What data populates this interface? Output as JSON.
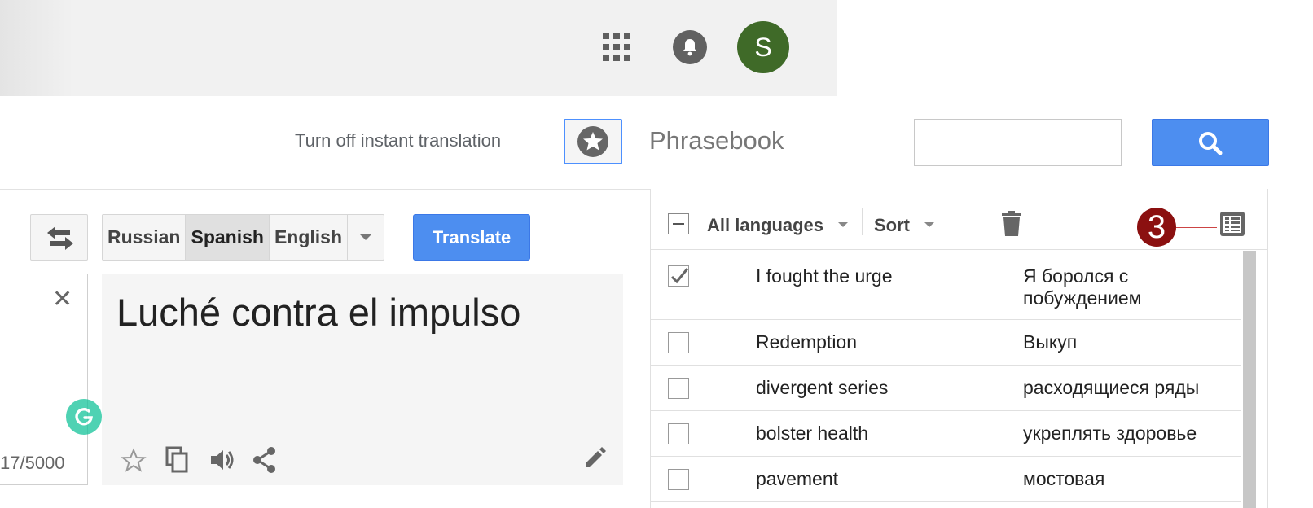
{
  "header": {
    "apps_icon": "apps-grid-icon",
    "notifications_icon": "bell-icon",
    "avatar_letter": "S"
  },
  "toolbar": {
    "instant_translation_label": "Turn off instant translation",
    "phrasebook_title": "Phrasebook",
    "search_placeholder": ""
  },
  "translate": {
    "languages": [
      "Russian",
      "Spanish",
      "English"
    ],
    "selected_language": "Spanish",
    "translate_label": "Translate",
    "result_text": "Luché contra el impulso",
    "char_count": "17/5000"
  },
  "phrasebook": {
    "language_filter": "All languages",
    "sort_label": "Sort",
    "badge": "3",
    "rows": [
      {
        "source": "I fought the urge",
        "target": "Я боролся с побуждением",
        "checked": true
      },
      {
        "source": "Redemption",
        "target": "Выкуп",
        "checked": false
      },
      {
        "source": "divergent series",
        "target": "расходящиеся ряды",
        "checked": false
      },
      {
        "source": "bolster health",
        "target": "укреплять здоровье",
        "checked": false
      },
      {
        "source": "pavement",
        "target": "мостовая",
        "checked": false
      }
    ]
  },
  "colors": {
    "accent_blue": "#4d8ef0",
    "avatar_green": "#3f6a28",
    "badge_red": "#8b1010"
  }
}
